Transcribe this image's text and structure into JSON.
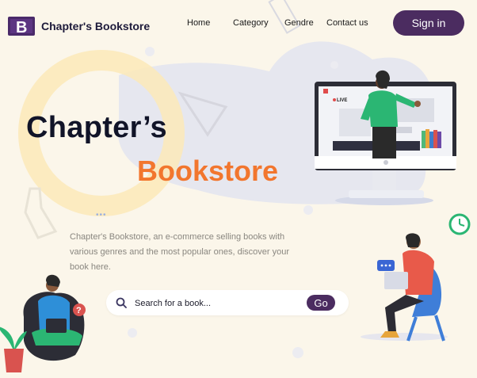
{
  "brand": {
    "name": "Chapter's Bookstore",
    "logo_letter": "B"
  },
  "nav": {
    "items": [
      "Home",
      "Category",
      "Gendre",
      "Contact us"
    ]
  },
  "header": {
    "signin_label": "Sign in"
  },
  "hero": {
    "title_line1": "Chapter’s",
    "title_line2": "Bookstore",
    "description": "Chapter's Bookstore, an e-commerce selling books with various genres and the most popular ones, discover your book here."
  },
  "search": {
    "placeholder": "Search for a book...",
    "button_label": "Go"
  },
  "illustration": {
    "live_badge": "LIVE"
  },
  "colors": {
    "accent": "#4b2c60",
    "orange": "#f2762e",
    "background": "#fbf6ea"
  }
}
